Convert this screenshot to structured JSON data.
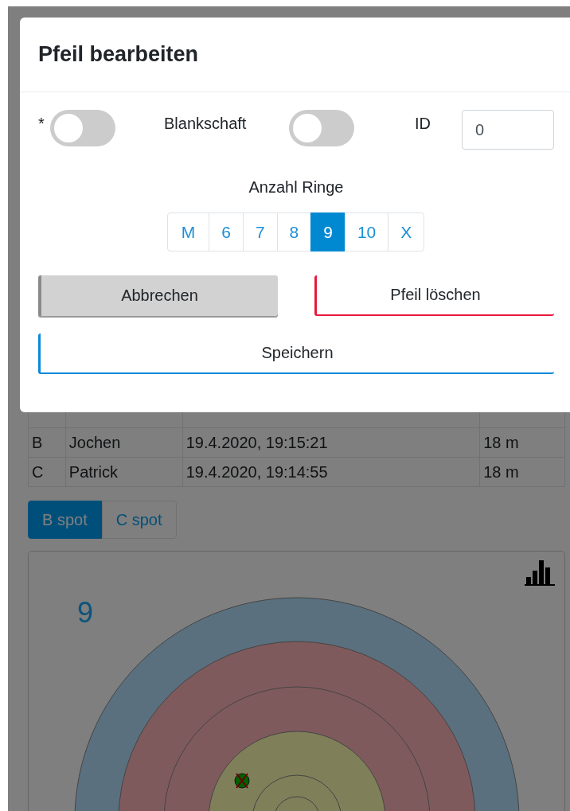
{
  "modal": {
    "title": "Pfeil bearbeiten",
    "toggles": [
      {
        "label": "*",
        "on": false
      },
      {
        "label": "Blankschaft",
        "on": false
      }
    ],
    "id_field": {
      "label": "ID",
      "value": "0"
    },
    "rings": {
      "label": "Anzahl Ringe",
      "options": [
        {
          "label": "M",
          "selected": false
        },
        {
          "label": "6",
          "selected": false
        },
        {
          "label": "7",
          "selected": false
        },
        {
          "label": "8",
          "selected": false
        },
        {
          "label": "9",
          "selected": true
        },
        {
          "label": "10",
          "selected": false
        },
        {
          "label": "X",
          "selected": false
        }
      ]
    },
    "buttons": [
      {
        "label": "Abbrechen",
        "kind": "secondary"
      },
      {
        "label": "Pfeil löschen",
        "kind": "danger"
      },
      {
        "label": "Speichern",
        "kind": "primary"
      }
    ]
  },
  "table": {
    "rows": [
      [
        "B",
        "Jochen",
        "19.4.2020, 19:15:21",
        "18 m"
      ],
      [
        "C",
        "Patrick",
        "19.4.2020, 19:14:55",
        "18 m"
      ]
    ]
  },
  "tabs": [
    {
      "label": "B spot",
      "selected": true
    },
    {
      "label": "C spot",
      "selected": false
    }
  ],
  "target": {
    "score": "9"
  }
}
